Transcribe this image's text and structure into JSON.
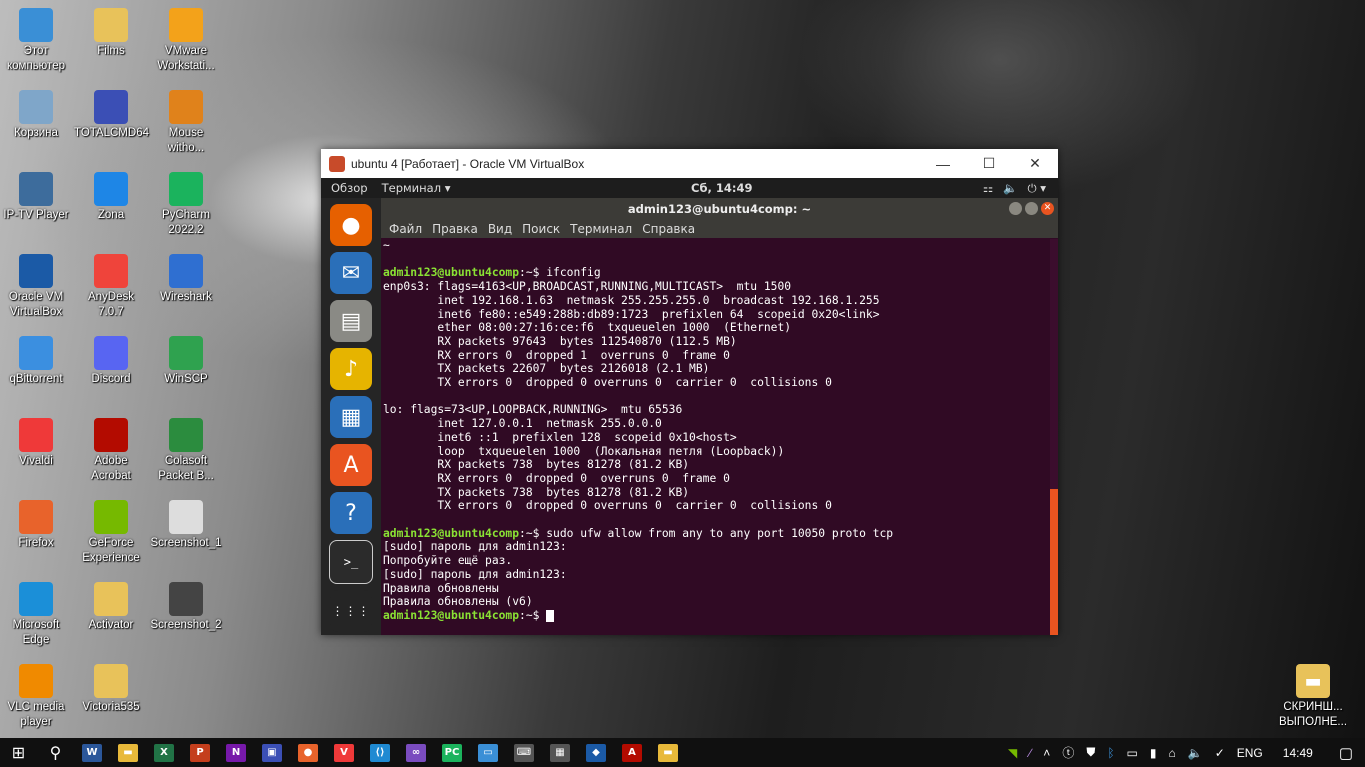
{
  "desktop_icons": [
    {
      "label": "Этот\nкомпьютер",
      "icon": "monitor-icon",
      "color": "#3a8fd6"
    },
    {
      "label": "Films",
      "icon": "folder-icon",
      "color": "#e8c25a"
    },
    {
      "label": "VMware\nWorkstati...",
      "icon": "vmware-icon",
      "color": "#f3a21a"
    },
    {
      "label": "Корзина",
      "icon": "recycle-bin-icon",
      "color": "#7fa6c9"
    },
    {
      "label": "TOTALCMD64",
      "icon": "totalcmd-icon",
      "color": "#3b4fb5"
    },
    {
      "label": "Mouse\nwitho...",
      "icon": "mouse-icon",
      "color": "#e0821b"
    },
    {
      "label": "IP-TV Player",
      "icon": "iptv-icon",
      "color": "#3d6c9c"
    },
    {
      "label": "Zona",
      "icon": "zona-icon",
      "color": "#1e86e6"
    },
    {
      "label": "PyCharm\n2022.2",
      "icon": "pycharm-icon",
      "color": "#1bb35d"
    },
    {
      "label": "Oracle VM\nVirtualBox",
      "icon": "virtualbox-icon",
      "color": "#1b5aa6"
    },
    {
      "label": "AnyDesk\n7.0.7",
      "icon": "anydesk-icon",
      "color": "#ef443b"
    },
    {
      "label": "Wireshark",
      "icon": "wireshark-icon",
      "color": "#2f6fd1"
    },
    {
      "label": "qBittorrent",
      "icon": "qbittorrent-icon",
      "color": "#3b8fe0"
    },
    {
      "label": "Discord",
      "icon": "discord-icon",
      "color": "#5865f2"
    },
    {
      "label": "WinSCP",
      "icon": "winscp-icon",
      "color": "#2fa24f"
    },
    {
      "label": "Vivaldi",
      "icon": "vivaldi-icon",
      "color": "#ef3939"
    },
    {
      "label": "Adobe\nAcrobat",
      "icon": "acrobat-icon",
      "color": "#b30b00"
    },
    {
      "label": "Colasoft\nPacket B...",
      "icon": "colasoft-icon",
      "color": "#2b8c3e"
    },
    {
      "label": "Firefox",
      "icon": "firefox-icon",
      "color": "#e8632b"
    },
    {
      "label": "GeForce\nExperience",
      "icon": "geforce-icon",
      "color": "#76b900"
    },
    {
      "label": "Screenshot_1",
      "icon": "image-file-icon",
      "color": "#dddddd"
    },
    {
      "label": "Microsoft\nEdge",
      "icon": "edge-icon",
      "color": "#1b8fd8"
    },
    {
      "label": "Activator",
      "icon": "folder-icon",
      "color": "#e8c25a"
    },
    {
      "label": "Screenshot_2",
      "icon": "image-file-icon",
      "color": "#444444"
    },
    {
      "label": "VLC media\nplayer",
      "icon": "vlc-icon",
      "color": "#f08a00"
    },
    {
      "label": "Victoria535",
      "icon": "folder-icon",
      "color": "#e8c25a"
    }
  ],
  "desktop_right_icon": {
    "label": "СКРИНШ...\nВЫПОЛНЕ...",
    "icon": "folder-icon"
  },
  "vbox": {
    "title": "ubuntu 4 [Работает] - Oracle VM VirtualBox",
    "minimize": "—",
    "maximize": "☐",
    "close": "✕"
  },
  "gnome": {
    "activities": "Обзор",
    "app_menu": "Терминал ▾",
    "clock": "Сб, 14:49",
    "tray": [
      "⚏",
      "🔈",
      "⏻ ▾"
    ]
  },
  "dock": [
    {
      "icon": "firefox-icon",
      "color": "#e66000",
      "glyph": "●"
    },
    {
      "icon": "thunderbird-icon",
      "color": "#2a6fb9",
      "glyph": "✉"
    },
    {
      "icon": "files-icon",
      "color": "#8a8a85",
      "glyph": "▤"
    },
    {
      "icon": "rhythmbox-icon",
      "color": "#e6b400",
      "glyph": "♪"
    },
    {
      "icon": "writer-icon",
      "color": "#2a6fb9",
      "glyph": "▦"
    },
    {
      "icon": "software-icon",
      "color": "#e95420",
      "glyph": "A"
    },
    {
      "icon": "help-icon",
      "color": "#2a6fb9",
      "glyph": "?"
    },
    {
      "icon": "terminal-icon",
      "color": "#2b2b2b",
      "glyph": ">_"
    },
    {
      "icon": "show-apps-icon",
      "color": "#252525",
      "glyph": "⋮⋮⋮"
    }
  ],
  "terminal": {
    "title": "admin123@ubuntu4comp: ~",
    "menu": [
      "Файл",
      "Правка",
      "Вид",
      "Поиск",
      "Терминал",
      "Справка"
    ],
    "lines": [
      {
        "prompt": "",
        "text": "~"
      },
      {
        "prompt": "",
        "text": ""
      },
      {
        "prompt": "admin123@ubuntu4comp",
        "text": ":~$ ifconfig"
      },
      {
        "prompt": "",
        "text": "enp0s3: flags=4163<UP,BROADCAST,RUNNING,MULTICAST>  mtu 1500"
      },
      {
        "prompt": "",
        "text": "        inet 192.168.1.63  netmask 255.255.255.0  broadcast 192.168.1.255"
      },
      {
        "prompt": "",
        "text": "        inet6 fe80::e549:288b:db89:1723  prefixlen 64  scopeid 0x20<link>"
      },
      {
        "prompt": "",
        "text": "        ether 08:00:27:16:ce:f6  txqueuelen 1000  (Ethernet)"
      },
      {
        "prompt": "",
        "text": "        RX packets 97643  bytes 112540870 (112.5 MB)"
      },
      {
        "prompt": "",
        "text": "        RX errors 0  dropped 1  overruns 0  frame 0"
      },
      {
        "prompt": "",
        "text": "        TX packets 22607  bytes 2126018 (2.1 MB)"
      },
      {
        "prompt": "",
        "text": "        TX errors 0  dropped 0 overruns 0  carrier 0  collisions 0"
      },
      {
        "prompt": "",
        "text": ""
      },
      {
        "prompt": "",
        "text": "lo: flags=73<UP,LOOPBACK,RUNNING>  mtu 65536"
      },
      {
        "prompt": "",
        "text": "        inet 127.0.0.1  netmask 255.0.0.0"
      },
      {
        "prompt": "",
        "text": "        inet6 ::1  prefixlen 128  scopeid 0x10<host>"
      },
      {
        "prompt": "",
        "text": "        loop  txqueuelen 1000  (Локальная петля (Loopback))"
      },
      {
        "prompt": "",
        "text": "        RX packets 738  bytes 81278 (81.2 KB)"
      },
      {
        "prompt": "",
        "text": "        RX errors 0  dropped 0  overruns 0  frame 0"
      },
      {
        "prompt": "",
        "text": "        TX packets 738  bytes 81278 (81.2 KB)"
      },
      {
        "prompt": "",
        "text": "        TX errors 0  dropped 0 overruns 0  carrier 0  collisions 0"
      },
      {
        "prompt": "",
        "text": ""
      },
      {
        "prompt": "admin123@ubuntu4comp",
        "text": ":~$ sudo ufw allow from any to any port 10050 proto tcp"
      },
      {
        "prompt": "",
        "text": "[sudo] пароль для admin123:"
      },
      {
        "prompt": "",
        "text": "Попробуйте ещё раз."
      },
      {
        "prompt": "",
        "text": "[sudo] пароль для admin123:"
      },
      {
        "prompt": "",
        "text": "Правила обновлены"
      },
      {
        "prompt": "",
        "text": "Правила обновлены (v6)"
      },
      {
        "prompt": "admin123@ubuntu4comp",
        "text": ":~$ "
      }
    ]
  },
  "taskbar": {
    "apps": [
      {
        "icon": "word-icon",
        "color": "#2b579a",
        "glyph": "W"
      },
      {
        "icon": "file-explorer-icon",
        "color": "#e8b93a",
        "glyph": "▬"
      },
      {
        "icon": "excel-icon",
        "color": "#217346",
        "glyph": "X"
      },
      {
        "icon": "powerpoint-icon",
        "color": "#c43e1c",
        "glyph": "P"
      },
      {
        "icon": "onenote-icon",
        "color": "#7719aa",
        "glyph": "N"
      },
      {
        "icon": "totalcmd-icon",
        "color": "#3b4fb5",
        "glyph": "▣"
      },
      {
        "icon": "firefox-icon",
        "color": "#e8632b",
        "glyph": "●"
      },
      {
        "icon": "vivaldi-icon",
        "color": "#ef3939",
        "glyph": "V"
      },
      {
        "icon": "vscode-icon",
        "color": "#1f8ad2",
        "glyph": "⟨⟩"
      },
      {
        "icon": "visual-studio-icon",
        "color": "#7a4cbf",
        "glyph": "∞"
      },
      {
        "icon": "pycharm-icon",
        "color": "#1bb35d",
        "glyph": "PC"
      },
      {
        "icon": "rdp-icon",
        "color": "#3a8fd6",
        "glyph": "▭"
      },
      {
        "icon": "keyboard-icon",
        "color": "#555555",
        "glyph": "⌨"
      },
      {
        "icon": "calculator-icon",
        "color": "#555555",
        "glyph": "▦"
      },
      {
        "icon": "virtualbox-icon",
        "color": "#1b5aa6",
        "glyph": "◆"
      },
      {
        "icon": "acrobat-icon",
        "color": "#b30b00",
        "glyph": "A"
      },
      {
        "icon": "folder-icon",
        "color": "#e8b93a",
        "glyph": "▬"
      }
    ],
    "language": "ENG",
    "time": "14:49"
  }
}
